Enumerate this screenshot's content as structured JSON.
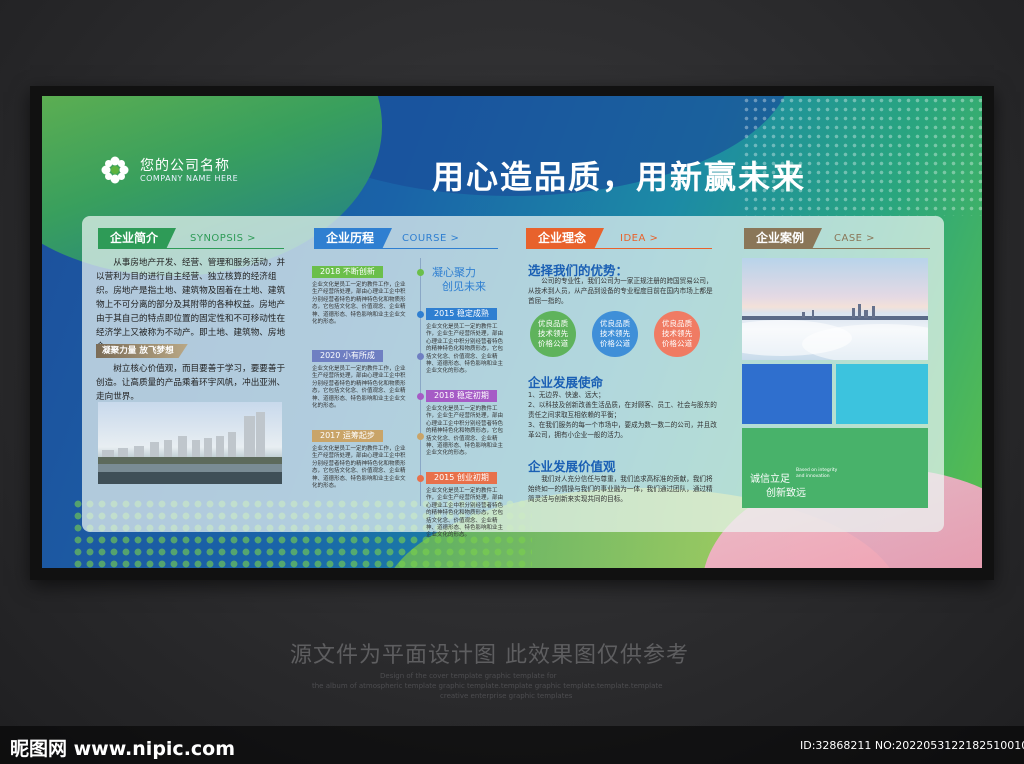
{
  "company": {
    "name_cn": "您的公司名称",
    "name_en": "COMPANY NAME HERE"
  },
  "slogan": "用心造品质，用新赢未来",
  "synopsis": {
    "tag": "企业简介",
    "tag_en": "SYNOPSIS >",
    "paragraph": "从事房地产开发、经营、管理和服务活动，并以营利为目的进行自主经营、独立核算的经济组织。房地产是指土地、建筑物及固着在土地、建筑物上不可分离的部分及其附带的各种权益。房地产由于其自己的特点即位置的固定性和不可移动性在经济学上又被称为不动产。即土地、建筑物、房地合一。",
    "sub_tag": "凝聚力量 放飞梦想",
    "sub_paragraph": "树立核心价值观，而目要善于学习，要要善于创造。让高质量的产品乘着环宇风帆，冲出亚洲、走向世界。"
  },
  "course": {
    "tag": "企业历程",
    "tag_en": "COURSE >",
    "motto_1": "凝心聚力",
    "motto_2": "创见未来",
    "items": [
      {
        "label": "2018 不断创新",
        "color": "#6bbf4a",
        "text": "企业文化是员工一定的教件工作，企业生产经营所处理，部由心理业工企中积分别经营者特色的精神特色化和物质形态，它包括文化念、价值观念、企业精神、道德形态、特色影响和业主企业文化的形态。"
      },
      {
        "label": "2015 稳定成熟",
        "color": "#2f7fd1",
        "text": "企业文化是员工一定的教件工作，企业生产经营所处理，部由心理业工企中积分别经营者特色的精神特色化和物质形态，它包括文化念、价值观念、企业精神、道德形态、特色影响和业主企业文化的形态。"
      },
      {
        "label": "2020 小有所成",
        "color": "#6f7fc2",
        "text": "企业文化是员工一定的教件工作，企业生产经营所处理，部由心理业工企中积分别经营者特色的精神特色化和物质形态，它包括文化念、价值观念、企业精神、道德形态、特色影响和业主企业文化的形态。"
      },
      {
        "label": "2018 稳定初期",
        "color": "#a65bc6",
        "text": "企业文化是员工一定的教件工作，企业生产经营所处理，部由心理业工企中积分别经营者特色的精神特色化和物质形态，它包括文化念、价值观念、企业精神、道德形态、特色影响和业主企业文化的形态。"
      },
      {
        "label": "2017 运筹起步",
        "color": "#c9a468",
        "text": "企业文化是员工一定的教件工作，企业生产经营所处理，部由心理业工企中积分别经营者特色的精神特色化和物质形态，它包括文化念、价值观念、企业精神、道德形态、特色影响和业主企业文化的形态。"
      },
      {
        "label": "2015 创业初期",
        "color": "#e8704a",
        "text": "企业文化是员工一定的教件工作，企业生产经营所处理，部由心理业工企中积分别经营者特色的精神特色化和物质形态，它包括文化念、价值观念、企业精神、道德形态、特色影响和业主企业文化的形态。"
      }
    ]
  },
  "idea": {
    "tag": "企业理念",
    "tag_en": "IDEA >",
    "heading": "选择我们的优势：",
    "intro": "公司的专业性，我们公司为一家正规注册的跨国贸易公司，从技术到人员，从产品到设备的专业程度目前在国内市场上都是首屈一指的。",
    "circles": [
      {
        "l1": "优良品质",
        "l2": "技术领先",
        "l3": "价格公道",
        "color": "#5fb35c"
      },
      {
        "l1": "优良品质",
        "l2": "技术领先",
        "l3": "价格公道",
        "color": "#3f8fd8"
      },
      {
        "l1": "优良品质",
        "l2": "技术领先",
        "l3": "价格公道",
        "color": "#f07b63"
      }
    ],
    "mission_heading": "企业发展使命",
    "mission_text": "1、无边界、快速、远大；\n2、以科技及创新改善生活品质，在对顾客、员工、社会与股东的责任之间求取互相依赖的平衡；\n3、在我们服务的每一个市场中，要成为数一数二的公司，并且改革公司，拥有小企业一般的活力。",
    "values_heading": "企业发展价值观",
    "values_text": "我们对人充分信任与尊重，我们追求高标准的贡献，我们将始终如一的情操与我们的事业融为一体，我们通过团队，通过精简灵活与创新来实现共同的目标。"
  },
  "case": {
    "tag": "企业案例",
    "tag_en": "CASE >",
    "tile_cn_1": "诚信立足",
    "tile_cn_2": "创新致远",
    "tile_en_1": "Based on integrity",
    "tile_en_2": "and innovation"
  },
  "watermark": {
    "caption": "源文件为平面设计图 此效果图仅供参考",
    "lines": [
      "Design of the cover template graphic template for",
      "the album of atmospheric template graphic template.template graphic template.template.template",
      "creative enterprise graphic templates"
    ],
    "site": "昵图网 www.nipic.com",
    "id": "ID:32868211 NO:20220531221825100104"
  },
  "colors": {
    "tag_green": "#2e9b57",
    "tag_blue": "#2f7fd1",
    "tag_orange": "#e8622c",
    "tag_brown": "#8a7658",
    "tile_blue": "#2f6fce",
    "tile_cyan": "#3cc3de",
    "tile_green": "#48b26a"
  }
}
